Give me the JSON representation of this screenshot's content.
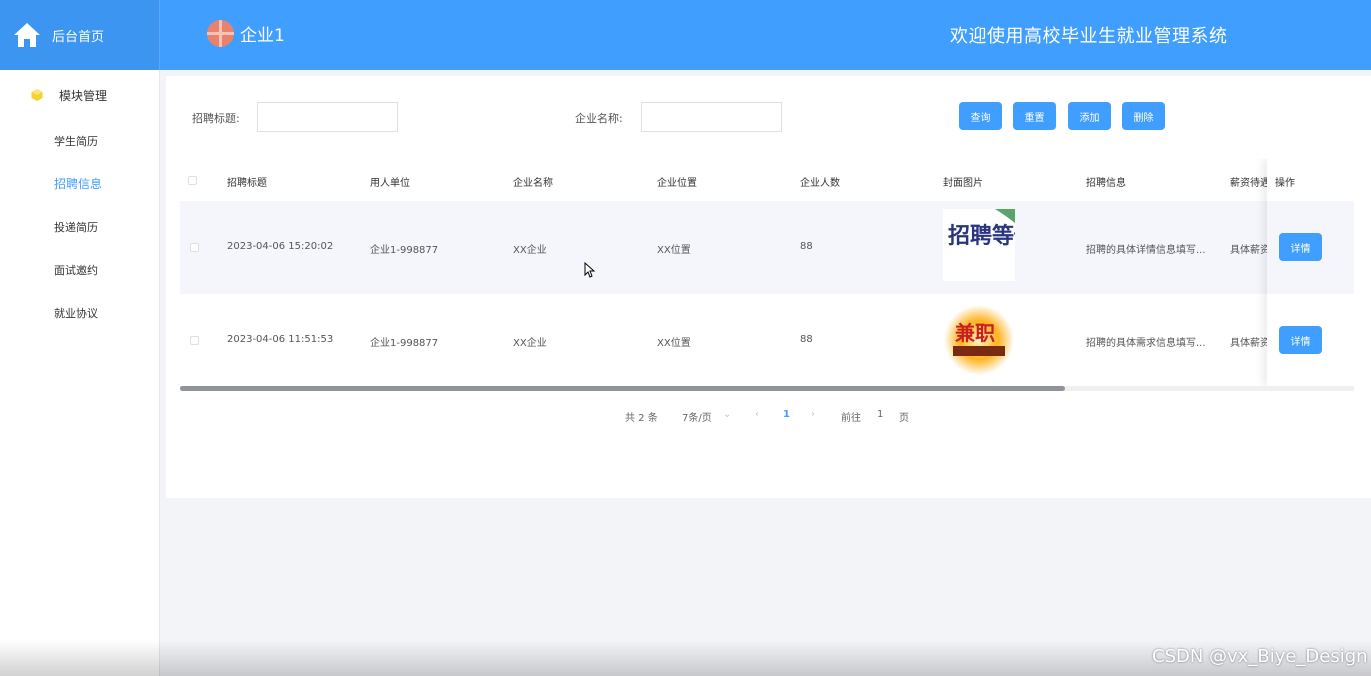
{
  "header": {
    "home_label": "后台首页",
    "org_name": "企业1",
    "system_title": "欢迎使用高校毕业生就业管理系统"
  },
  "sidebar": {
    "group_label": "模块管理",
    "items": [
      {
        "label": "学生简历"
      },
      {
        "label": "招聘信息"
      },
      {
        "label": "投递简历"
      },
      {
        "label": "面试邀约"
      },
      {
        "label": "就业协议"
      }
    ]
  },
  "search": {
    "title_label": "招聘标题:",
    "title_value": "",
    "company_label": "企业名称:",
    "company_value": ""
  },
  "buttons": {
    "query": "查询",
    "reset": "重置",
    "add": "添加",
    "delete": "删除"
  },
  "table": {
    "headers": [
      "招聘标题",
      "用人单位",
      "企业名称",
      "企业位置",
      "企业人数",
      "封面图片",
      "招聘信息",
      "薪资待遇",
      "操作"
    ],
    "rows": [
      {
        "title": "2023-04-06 15:20:02",
        "employer": "企业1-998877",
        "company": "XX企业",
        "location": "XX位置",
        "headcount": "88",
        "cover_text": "招聘等你来!",
        "info": "招聘的具体详情信息填写...",
        "salary": "具体薪资",
        "action": "详情"
      },
      {
        "title": "2023-04-06 11:51:53",
        "employer": "企业1-998877",
        "company": "XX企业",
        "location": "XX位置",
        "headcount": "88",
        "cover_text": "兼职",
        "info": "招聘的具体需求信息填写...",
        "salary": "具体薪资",
        "action": "详情"
      }
    ]
  },
  "pagination": {
    "total": "共 2 条",
    "page_size": "7条/页",
    "current_page": "1",
    "goto_label": "前往",
    "goto_value": "1",
    "page_unit": "页"
  },
  "watermark": "CSDN @vx_Biye_Design",
  "colors": {
    "primary": "#409eff",
    "header": "#409eff",
    "row_alt": "#f4f6fb"
  }
}
